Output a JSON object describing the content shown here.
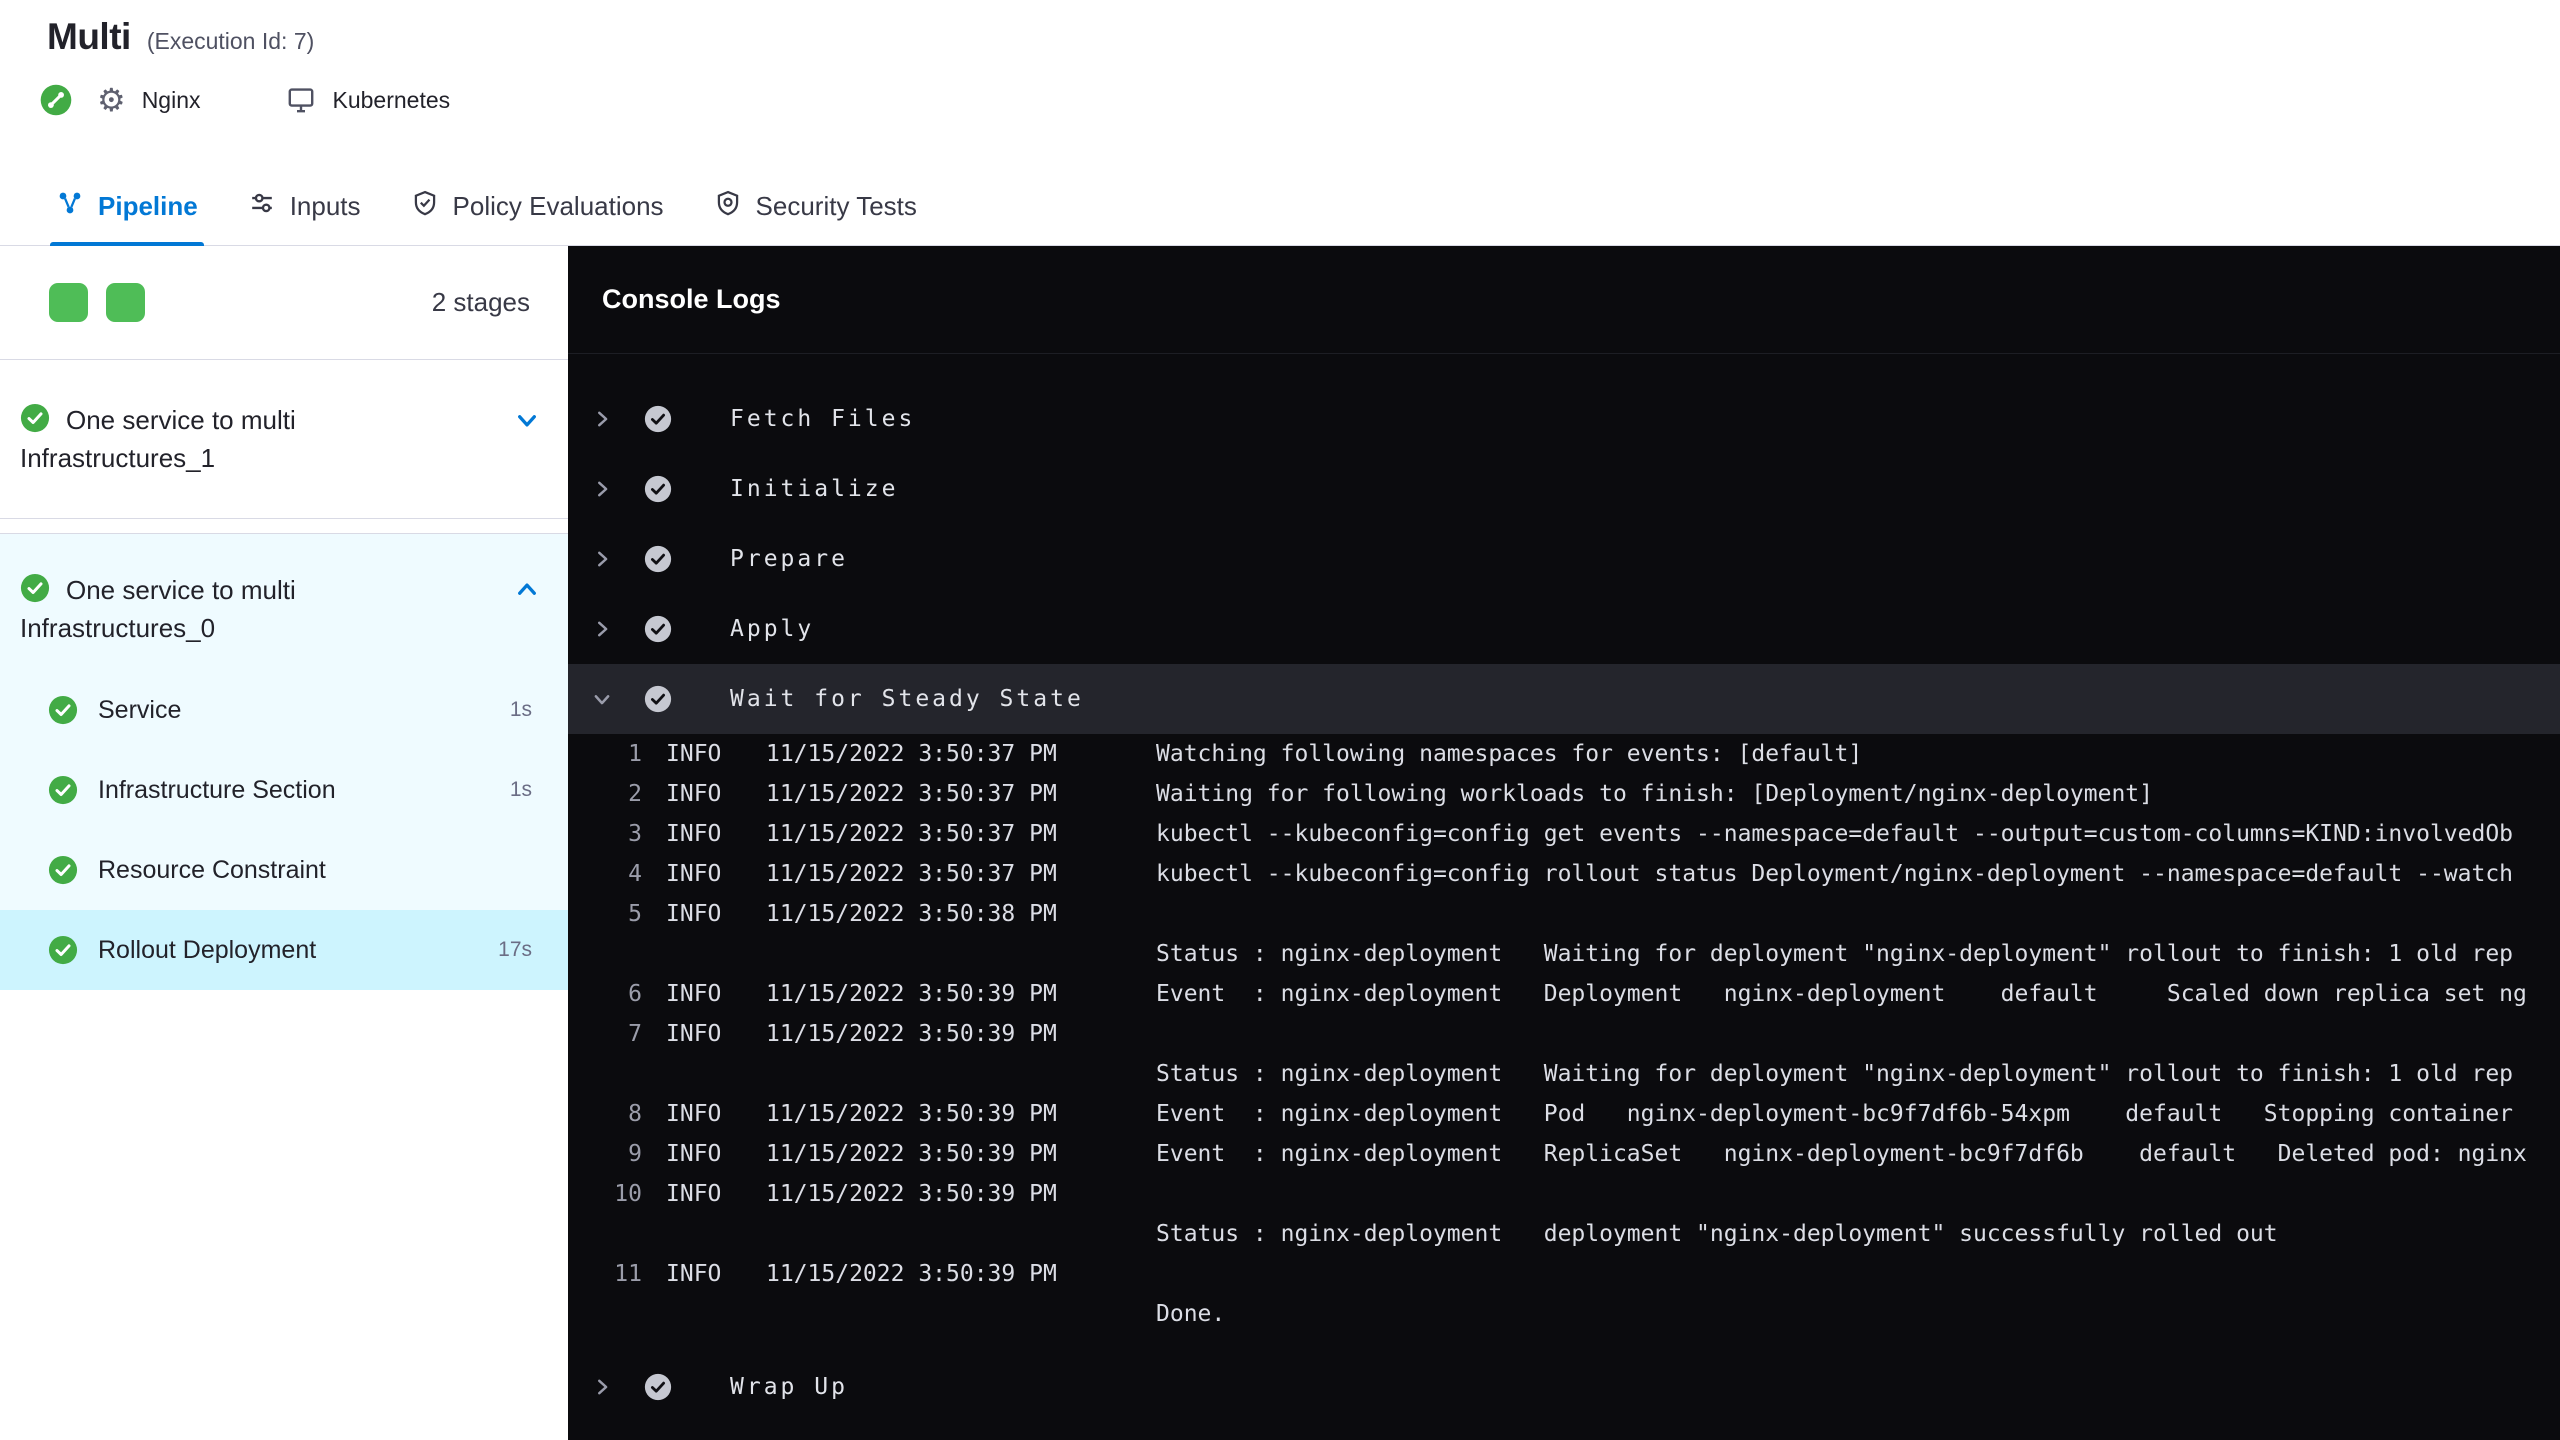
{
  "header": {
    "title": "Multi",
    "execution_id": "(Execution Id: 7)",
    "service_name": "Nginx",
    "environment_name": "Kubernetes",
    "gear_glyph": "⚙"
  },
  "tabs": [
    {
      "label": "Pipeline",
      "active": true
    },
    {
      "label": "Inputs",
      "active": false
    },
    {
      "label": "Policy Evaluations",
      "active": false
    },
    {
      "label": "Security Tests",
      "active": false
    }
  ],
  "sidebar": {
    "stages_count": "2 stages",
    "stages": [
      {
        "title_line1": "One service to multi",
        "title_line2": "Infrastructures_1",
        "expanded": false
      },
      {
        "title_line1": "One service to multi",
        "title_line2": "Infrastructures_0",
        "expanded": true,
        "steps": [
          {
            "label": "Service",
            "duration": "1s",
            "selected": false
          },
          {
            "label": "Infrastructure Section",
            "duration": "1s",
            "selected": false
          },
          {
            "label": "Resource Constraint",
            "duration": "",
            "selected": false
          },
          {
            "label": "Rollout Deployment",
            "duration": "17s",
            "selected": true
          }
        ]
      }
    ]
  },
  "console": {
    "title": "Console Logs",
    "steps_before": [
      "Fetch Files",
      "Initialize",
      "Prepare",
      "Apply"
    ],
    "expanded_step": "Wait for Steady State",
    "steps_after": [
      "Wrap Up"
    ],
    "logs": [
      {
        "num": "1",
        "level": "INFO",
        "time": "11/15/2022 3:50:37 PM",
        "lines": [
          "Watching following namespaces for events: [default]"
        ]
      },
      {
        "num": "2",
        "level": "INFO",
        "time": "11/15/2022 3:50:37 PM",
        "lines": [
          "Waiting for following workloads to finish: [Deployment/nginx-deployment]"
        ]
      },
      {
        "num": "3",
        "level": "INFO",
        "time": "11/15/2022 3:50:37 PM",
        "lines": [
          "kubectl --kubeconfig=config get events --namespace=default --output=custom-columns=KIND:involvedOb"
        ]
      },
      {
        "num": "4",
        "level": "INFO",
        "time": "11/15/2022 3:50:37 PM",
        "lines": [
          "kubectl --kubeconfig=config rollout status Deployment/nginx-deployment --namespace=default --watch"
        ]
      },
      {
        "num": "5",
        "level": "INFO",
        "time": "11/15/2022 3:50:38 PM",
        "lines": [
          "",
          "Status : nginx-deployment   Waiting for deployment \"nginx-deployment\" rollout to finish: 1 old rep"
        ]
      },
      {
        "num": "6",
        "level": "INFO",
        "time": "11/15/2022 3:50:39 PM",
        "lines": [
          "Event  : nginx-deployment   Deployment   nginx-deployment    default     Scaled down replica set ng"
        ]
      },
      {
        "num": "7",
        "level": "INFO",
        "time": "11/15/2022 3:50:39 PM",
        "lines": [
          "",
          "Status : nginx-deployment   Waiting for deployment \"nginx-deployment\" rollout to finish: 1 old rep"
        ]
      },
      {
        "num": "8",
        "level": "INFO",
        "time": "11/15/2022 3:50:39 PM",
        "lines": [
          "Event  : nginx-deployment   Pod   nginx-deployment-bc9f7df6b-54xpm    default   Stopping container"
        ]
      },
      {
        "num": "9",
        "level": "INFO",
        "time": "11/15/2022 3:50:39 PM",
        "lines": [
          "Event  : nginx-deployment   ReplicaSet   nginx-deployment-bc9f7df6b    default   Deleted pod: nginx"
        ]
      },
      {
        "num": "10",
        "level": "INFO",
        "time": "11/15/2022 3:50:39 PM",
        "lines": [
          "",
          "Status : nginx-deployment   deployment \"nginx-deployment\" successfully rolled out"
        ]
      },
      {
        "num": "11",
        "level": "INFO",
        "time": "11/15/2022 3:50:39 PM",
        "lines": [
          "",
          "Done."
        ]
      }
    ]
  },
  "colors": {
    "accent_blue": "#0278d5",
    "success_green": "#42ab45",
    "selected_step_bg": "#cdf4fe",
    "expanded_stage_bg": "#effbff",
    "console_bg": "#0b0b0e",
    "expanded_console_row_bg": "#24252c"
  }
}
